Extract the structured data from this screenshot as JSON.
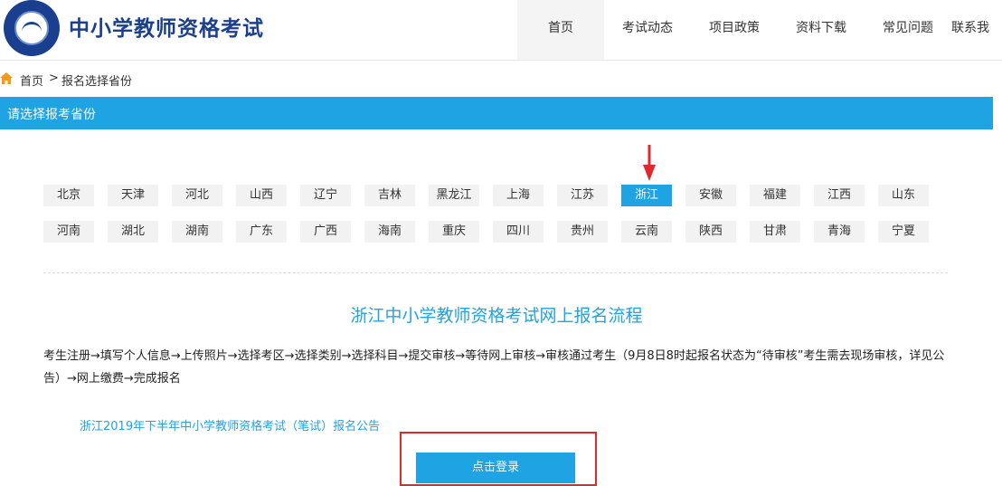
{
  "header": {
    "site_title": "中小学教师资格考试",
    "nav": [
      {
        "label": "首页",
        "active": true
      },
      {
        "label": "考试动态",
        "active": false
      },
      {
        "label": "项目政策",
        "active": false
      },
      {
        "label": "资料下载",
        "active": false
      },
      {
        "label": "常见问题",
        "active": false
      },
      {
        "label": "联系我",
        "active": false
      }
    ]
  },
  "breadcrumb": {
    "home": "首页",
    "separator": ">",
    "current": "报名选择省份"
  },
  "section": {
    "title": "请选择报考省份"
  },
  "provinces": {
    "selected": "浙江",
    "row1": [
      "北京",
      "天津",
      "河北",
      "山西",
      "辽宁",
      "吉林",
      "黑龙江",
      "上海",
      "江苏",
      "浙江",
      "安徽",
      "福建",
      "江西",
      "山东"
    ],
    "row2": [
      "河南",
      "湖北",
      "湖南",
      "广东",
      "广西",
      "海南",
      "重庆",
      "四川",
      "贵州",
      "云南",
      "陕西",
      "甘肃",
      "青海",
      "宁夏"
    ]
  },
  "flow": {
    "title": "浙江中小学教师资格考试网上报名流程",
    "text": "考生注册→填写个人信息→上传照片→选择考区→选择类别→选择科目→提交审核→等待网上审核→审核通过考生（9月8日8时起报名状态为“待审核”考生需去现场审核，详见公告）→网上缴费→完成报名"
  },
  "notice": {
    "link": "浙江2019年下半年中小学教师资格考试（笔试）报名公告"
  },
  "login": {
    "label": "点击登录"
  },
  "colors": {
    "brand_blue": "#1b3f8f",
    "accent": "#1fa3e3",
    "annotation_red": "#e0282e"
  }
}
